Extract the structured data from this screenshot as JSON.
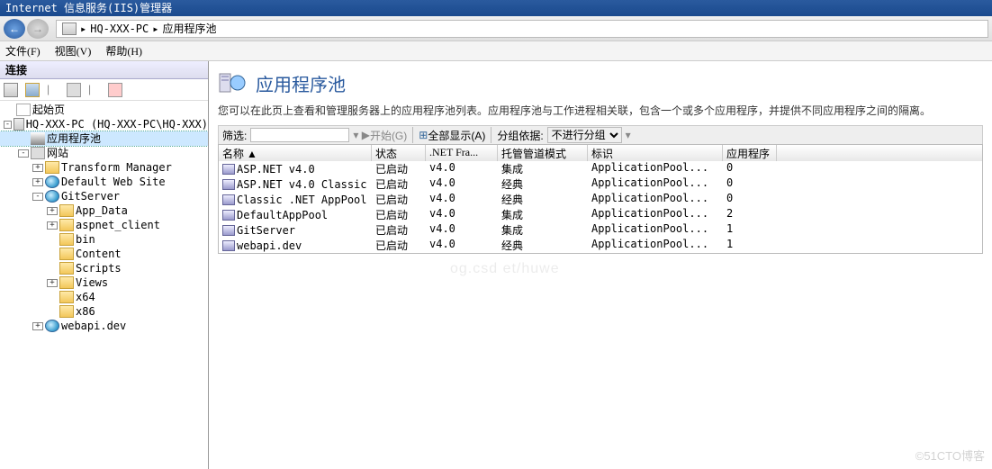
{
  "titlebar": "Internet 信息服务(IIS)管理器",
  "breadcrumb": {
    "sep": "▸",
    "items": [
      "HQ-XXX-PC",
      "应用程序池"
    ]
  },
  "menu": {
    "file": "文件(F)",
    "view": "视图(V)",
    "help": "帮助(H)"
  },
  "sidebar": {
    "title": "连接",
    "nodes": {
      "start": "起始页",
      "server": "HQ-XXX-PC (HQ-XXX-PC\\HQ-XXX)",
      "apppool": "应用程序池",
      "sites": "网站",
      "tm": "Transform Manager",
      "dws": "Default Web Site",
      "gitserver": "GitServer",
      "appdata": "App_Data",
      "aspnet": "aspnet_client",
      "bin": "bin",
      "content": "Content",
      "scripts": "Scripts",
      "views": "Views",
      "x64": "x64",
      "x86": "x86",
      "webapi": "webapi.dev"
    }
  },
  "main": {
    "title": "应用程序池",
    "desc": "您可以在此页上查看和管理服务器上的应用程序池列表。应用程序池与工作进程相关联，包含一个或多个应用程序，并提供不同应用程序之间的隔离。",
    "toolbar": {
      "filter_label": "筛选:",
      "go_label": "开始(G)",
      "showall_label": "全部显示(A)",
      "groupby_label": "分组依据:",
      "groupby_value": "不进行分组"
    },
    "columns": [
      "名称 ▲",
      "状态",
      ".NET Fra...",
      "托管管道模式",
      "标识",
      "应用程序"
    ],
    "rows": [
      {
        "name": "ASP.NET v4.0",
        "status": "已启动",
        "net": "v4.0",
        "mode": "集成",
        "identity": "ApplicationPool...",
        "apps": "0"
      },
      {
        "name": "ASP.NET v4.0 Classic",
        "status": "已启动",
        "net": "v4.0",
        "mode": "经典",
        "identity": "ApplicationPool...",
        "apps": "0"
      },
      {
        "name": "Classic .NET AppPool",
        "status": "已启动",
        "net": "v4.0",
        "mode": "经典",
        "identity": "ApplicationPool...",
        "apps": "0"
      },
      {
        "name": "DefaultAppPool",
        "status": "已启动",
        "net": "v4.0",
        "mode": "集成",
        "identity": "ApplicationPool...",
        "apps": "2"
      },
      {
        "name": "GitServer",
        "status": "已启动",
        "net": "v4.0",
        "mode": "集成",
        "identity": "ApplicationPool...",
        "apps": "1"
      },
      {
        "name": "webapi.dev",
        "status": "已启动",
        "net": "v4.0",
        "mode": "经典",
        "identity": "ApplicationPool...",
        "apps": "1"
      }
    ]
  },
  "watermark": "©51CTO博客",
  "watermark2": "og.csd   et/huwe"
}
